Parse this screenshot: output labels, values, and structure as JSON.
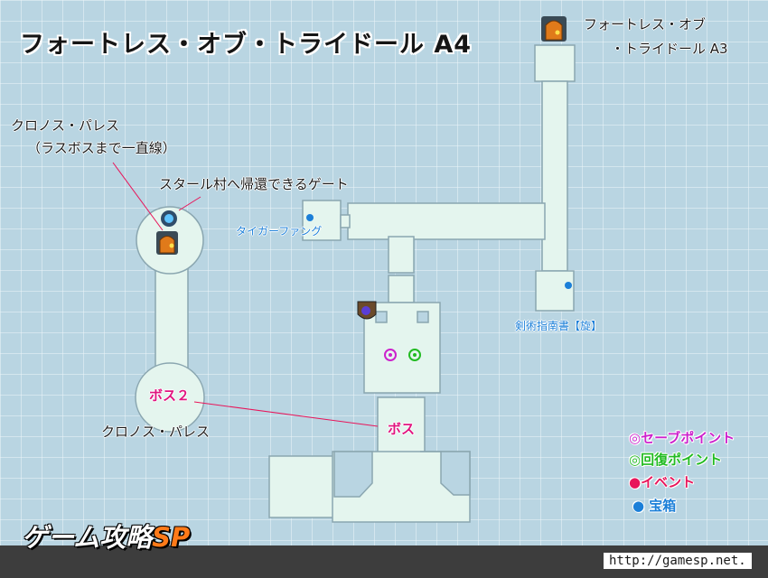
{
  "map": {
    "title": "フォートレス・オブ・トライドール A4",
    "exit_a3_line1": "フォートレス・オブ",
    "exit_a3_line2": "・トライドール A3",
    "chronos_line1": "クロノス・パレス",
    "chronos_line2": "（ラスボスまで一直線）",
    "return_gate": "スタール村へ帰還できるゲート",
    "chest_tiger_fang": "タイガーファング",
    "chest_swordbook": "剣術指南書【旋】",
    "boss2": "ボス２",
    "boss": "ボス",
    "chronos_bottom": "クロノス・パレス",
    "legend": {
      "save": "◎セーブポイント",
      "heal": "◎回復ポイント",
      "event": "●イベント",
      "chest": "● 宝箱"
    },
    "colors": {
      "background": "#b9d5e2",
      "grid": "#ffffff",
      "floor": "#e4f5ee",
      "floor_border": "#8aa6b0",
      "save": "#cc22cc",
      "heal": "#22bb22",
      "event": "#e8155a",
      "chest": "#1b7fd8",
      "brand_accent": "#ff7a18"
    }
  },
  "footer": {
    "brand_main": "ゲーム攻略",
    "brand_accent": "SP",
    "url": "http://gamesp.net."
  }
}
